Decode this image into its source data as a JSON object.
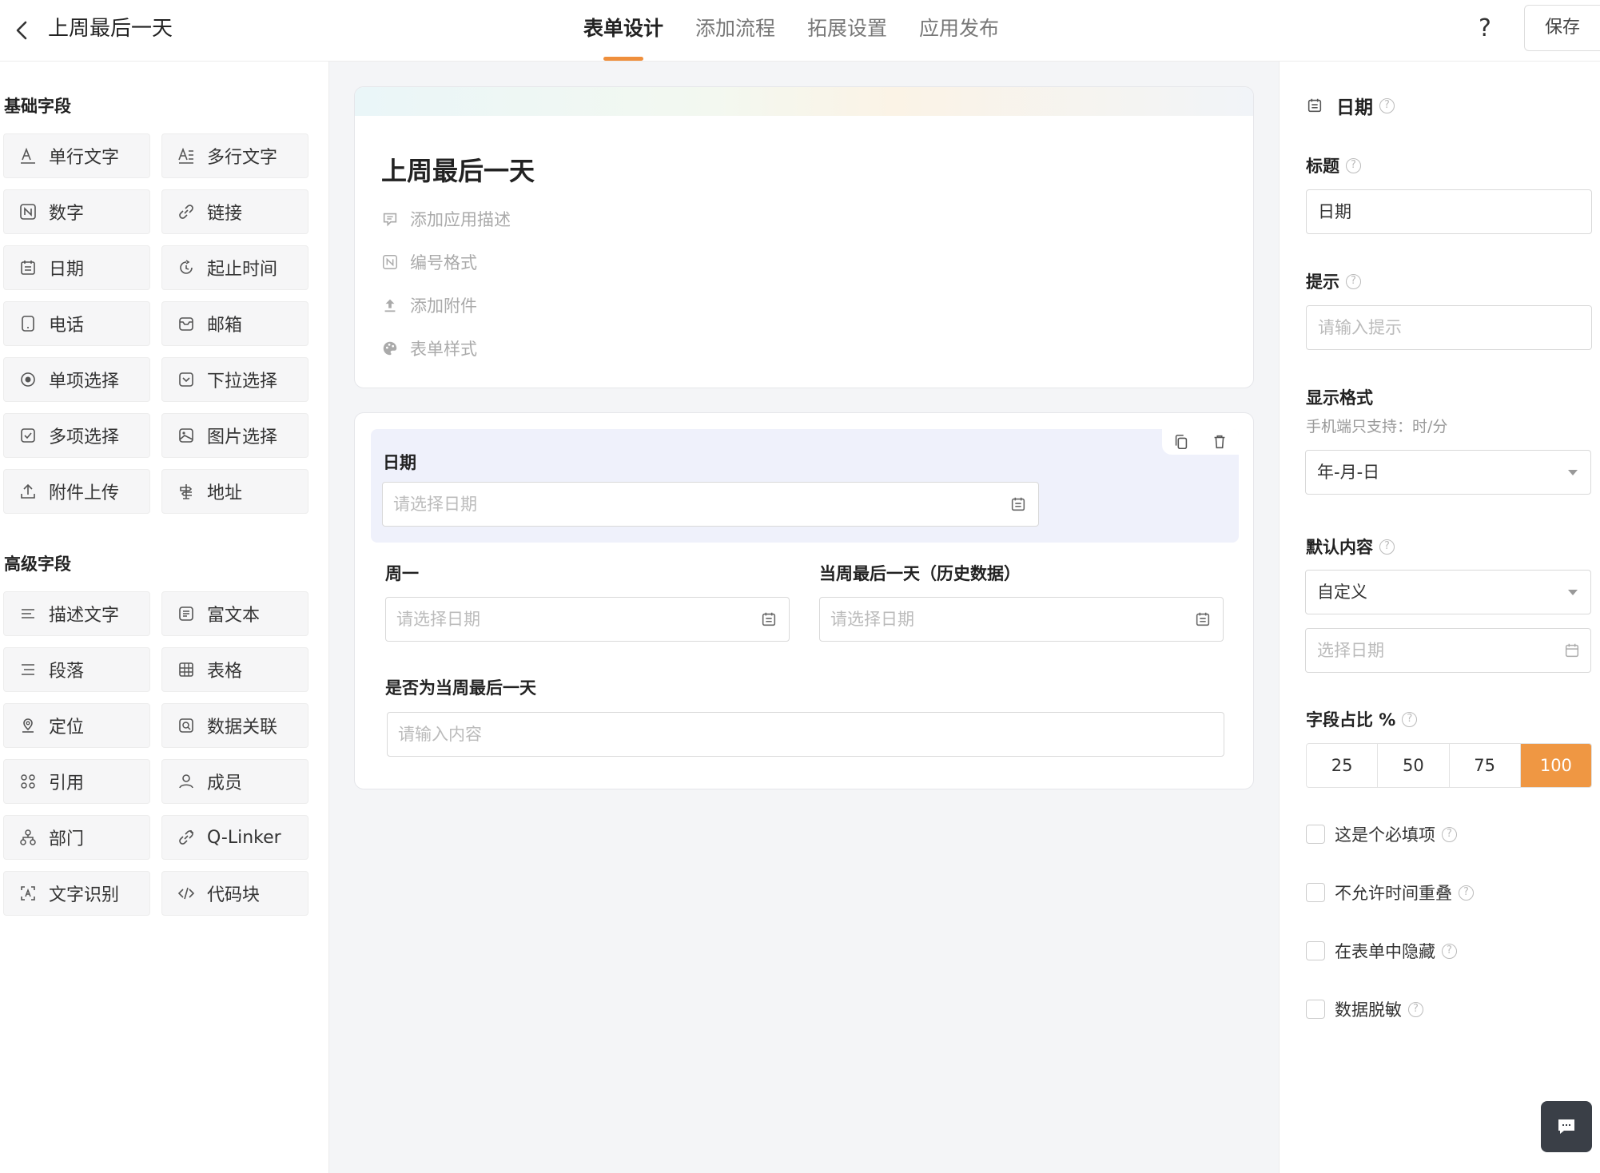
{
  "header": {
    "title": "上周最后一天",
    "tabs": [
      {
        "label": "表单设计",
        "active": true
      },
      {
        "label": "添加流程",
        "active": false
      },
      {
        "label": "拓展设置",
        "active": false
      },
      {
        "label": "应用发布",
        "active": false
      }
    ],
    "help_label": "?",
    "save_label": "保存",
    "accent": "#ef8f3c"
  },
  "left": {
    "basic_title": "基础字段",
    "basic_fields": [
      {
        "label": "单行文字",
        "icon": "text-icon"
      },
      {
        "label": "多行文字",
        "icon": "multiline-text-icon"
      },
      {
        "label": "数字",
        "icon": "number-icon"
      },
      {
        "label": "链接",
        "icon": "link-icon"
      },
      {
        "label": "日期",
        "icon": "calendar-icon"
      },
      {
        "label": "起止时间",
        "icon": "time-range-icon"
      },
      {
        "label": "电话",
        "icon": "phone-icon"
      },
      {
        "label": "邮箱",
        "icon": "mail-icon"
      },
      {
        "label": "单项选择",
        "icon": "radio-icon"
      },
      {
        "label": "下拉选择",
        "icon": "dropdown-icon"
      },
      {
        "label": "多项选择",
        "icon": "checkbox-icon"
      },
      {
        "label": "图片选择",
        "icon": "image-icon"
      },
      {
        "label": "附件上传",
        "icon": "upload-icon"
      },
      {
        "label": "地址",
        "icon": "signpost-icon"
      }
    ],
    "advanced_title": "高级字段",
    "advanced_fields": [
      {
        "label": "描述文字",
        "icon": "description-icon"
      },
      {
        "label": "富文本",
        "icon": "rich-text-icon"
      },
      {
        "label": "段落",
        "icon": "paragraph-icon"
      },
      {
        "label": "表格",
        "icon": "table-icon"
      },
      {
        "label": "定位",
        "icon": "location-icon"
      },
      {
        "label": "数据关联",
        "icon": "data-link-icon"
      },
      {
        "label": "引用",
        "icon": "reference-icon"
      },
      {
        "label": "成员",
        "icon": "member-icon"
      },
      {
        "label": "部门",
        "icon": "department-icon"
      },
      {
        "label": "Q-Linker",
        "icon": "qlinker-icon"
      },
      {
        "label": "文字识别",
        "icon": "ocr-icon"
      },
      {
        "label": "代码块",
        "icon": "code-icon"
      }
    ]
  },
  "form": {
    "title": "上周最后一天",
    "meta": [
      {
        "label": "添加应用描述",
        "icon": "comment-icon"
      },
      {
        "label": "编号格式",
        "icon": "number-icon"
      },
      {
        "label": "添加附件",
        "icon": "upload-icon"
      },
      {
        "label": "表单样式",
        "icon": "palette-icon"
      }
    ],
    "fields": {
      "date": {
        "label": "日期",
        "placeholder": "请选择日期"
      },
      "monday": {
        "label": "周一",
        "placeholder": "请选择日期"
      },
      "week_last": {
        "label": "当周最后一天（历史数据）",
        "placeholder": "请选择日期"
      },
      "is_last": {
        "label": "是否为当周最后一天",
        "placeholder": "请输入内容"
      }
    }
  },
  "props": {
    "header": "日期",
    "title_label": "标题",
    "title_value": "日期",
    "hint_label": "提示",
    "hint_placeholder": "请输入提示",
    "format_label": "显示格式",
    "format_note": "手机端只支持：时/分",
    "format_value": "年-月-日",
    "default_label": "默认内容",
    "default_value": "自定义",
    "default_date_placeholder": "选择日期",
    "width_label": "字段占比 %",
    "width_options": [
      "25",
      "50",
      "75",
      "100"
    ],
    "width_selected": "100",
    "width_accent": "#ef9743",
    "checks": [
      {
        "label": "这是个必填项",
        "checked": false
      },
      {
        "label": "不允许时间重叠",
        "checked": false
      },
      {
        "label": "在表单中隐藏",
        "checked": false
      },
      {
        "label": "数据脱敏",
        "checked": false
      }
    ],
    "help_mark": "?"
  }
}
